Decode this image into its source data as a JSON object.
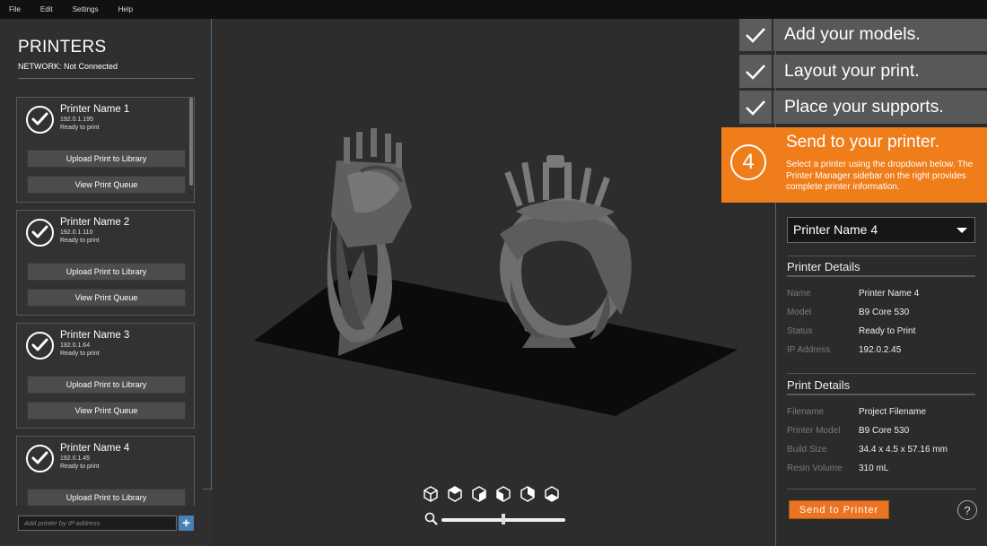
{
  "menu": [
    "File",
    "Edit",
    "Settings",
    "Help"
  ],
  "printers_panel": {
    "title": "PRINTERS",
    "network": "NETWORK: Not Connected",
    "upload_label": "Upload Print to Library",
    "queue_label": "View Print Queue",
    "items": [
      {
        "name": "Printer Name 1",
        "ip": "192.0.1.195",
        "status": "Ready to print"
      },
      {
        "name": "Printer Name 2",
        "ip": "192.0.1.110",
        "status": "Ready to print"
      },
      {
        "name": "Printer Name 3",
        "ip": "192.0.1.64",
        "status": "Ready to print"
      },
      {
        "name": "Printer Name 4",
        "ip": "192.0.1.45",
        "status": "Ready to print"
      }
    ],
    "add_placeholder": "Add printer by IP address",
    "add_button": "+"
  },
  "steps": [
    {
      "label": "Add your models.",
      "done": true
    },
    {
      "label": "Layout your print.",
      "done": true
    },
    {
      "label": "Place your supports.",
      "done": true
    }
  ],
  "active_step": {
    "number": "4",
    "title": "Send to your printer.",
    "description": "Select a printer using the dropdown below. The Printer Manager sidebar on the right provides complete printer information."
  },
  "printer_select": {
    "value": "Printer Name 4"
  },
  "printer_details": {
    "title": "Printer Details",
    "rows": [
      {
        "k": "Name",
        "v": "Printer Name 4"
      },
      {
        "k": "Model",
        "v": "B9 Core 530"
      },
      {
        "k": "Status",
        "v": "Ready to Print"
      },
      {
        "k": "IP Address",
        "v": "192.0.2.45"
      }
    ]
  },
  "print_details": {
    "title": "Print Details",
    "rows": [
      {
        "k": "Filename",
        "v": "Project Filename"
      },
      {
        "k": "Printer Model",
        "v": "B9 Core 530"
      },
      {
        "k": "Build Size",
        "v": "34.4 x 4.5 x 57.16 mm"
      },
      {
        "k": "Resin Volume",
        "v": "310 mL"
      }
    ]
  },
  "send_button": "Send to Printer",
  "help_button": "?",
  "zoom_level": 0.5,
  "colors": {
    "accent": "#ef7d19",
    "add_button": "#4a80b8",
    "border_blue": "#4a6c83"
  }
}
